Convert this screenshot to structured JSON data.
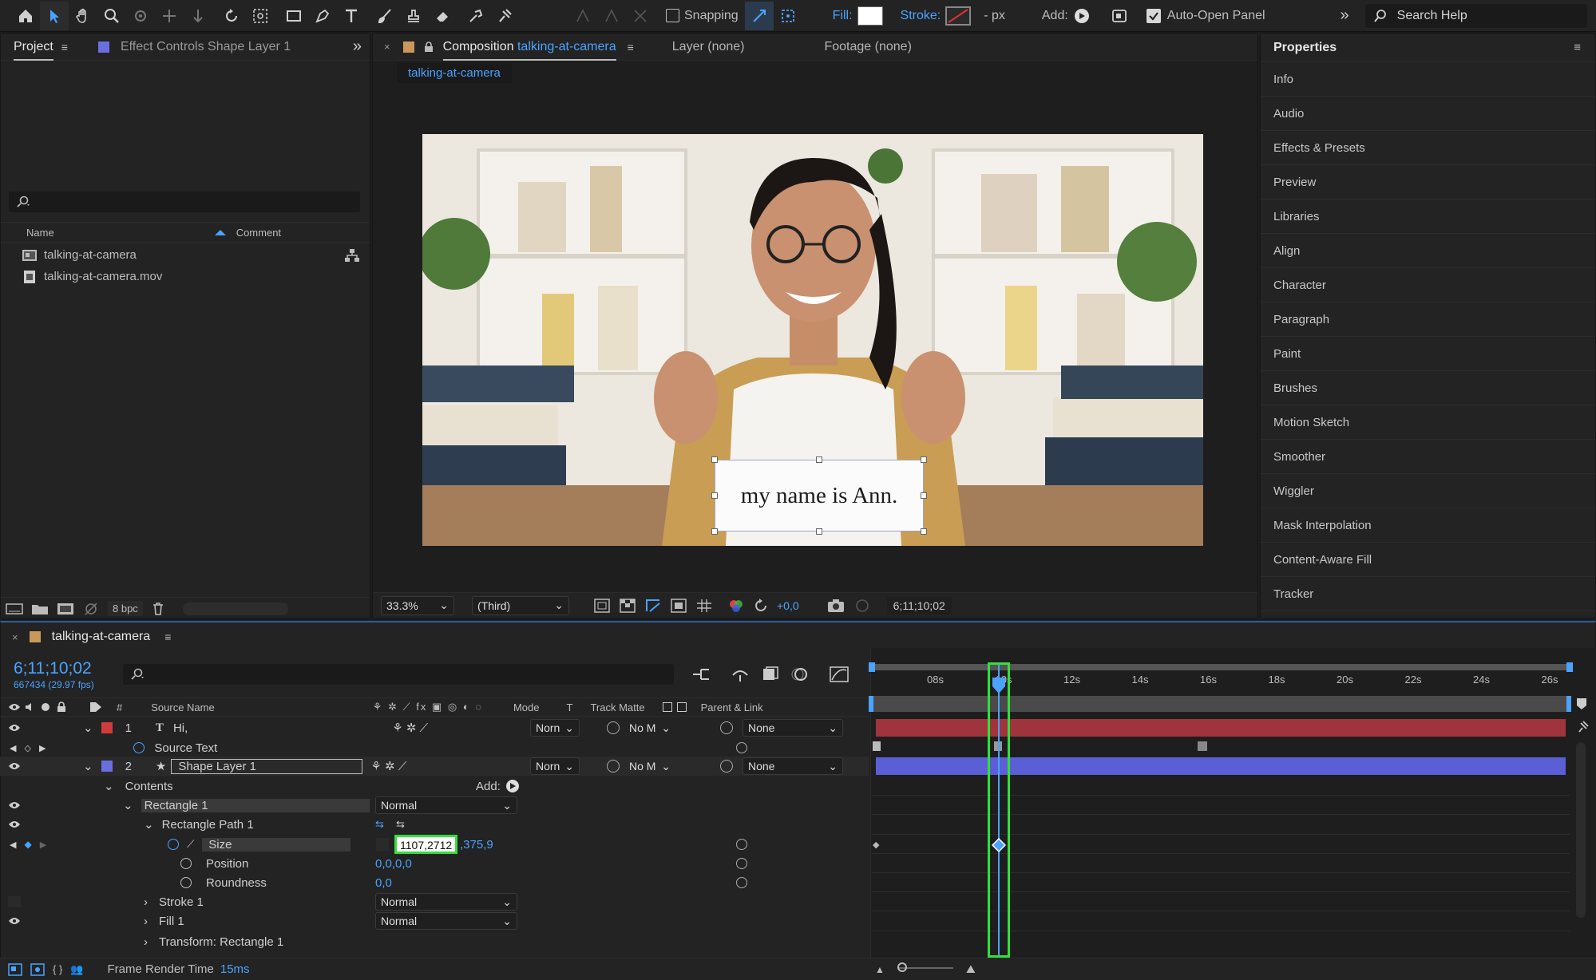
{
  "toolbar": {
    "snapping_label": "Snapping",
    "fill_label": "Fill:",
    "stroke_label": "Stroke:",
    "px_label": "- px",
    "add_label": "Add:",
    "auto_open_label": "Auto-Open Panel",
    "search_placeholder": "Search Help"
  },
  "project_panel": {
    "tab_project": "Project",
    "tab_effect_controls": "Effect Controls Shape Layer 1",
    "col_name": "Name",
    "col_comment": "Comment",
    "items": [
      {
        "name": "talking-at-camera",
        "icon": "composition-icon"
      },
      {
        "name": "talking-at-camera.mov",
        "icon": "footage-icon"
      }
    ],
    "bpc_label": "8 bpc"
  },
  "comp_panel": {
    "tab_prefix": "Composition",
    "tab_comp_name": "talking-at-camera",
    "tab_layer": "Layer (none)",
    "tab_footage": "Footage (none)",
    "subtab": "talking-at-camera",
    "caption_text": "my name is Ann.",
    "zoom_value": "33.3%",
    "resolution_value": "(Third)",
    "exposure_value": "+0,0",
    "timecode": "6;11;10;02"
  },
  "properties_panel": {
    "title": "Properties",
    "items": [
      "Info",
      "Audio",
      "Effects & Presets",
      "Preview",
      "Libraries",
      "Align",
      "Character",
      "Paragraph",
      "Paint",
      "Brushes",
      "Motion Sketch",
      "Smoother",
      "Wiggler",
      "Mask Interpolation",
      "Content-Aware Fill",
      "Tracker"
    ]
  },
  "timeline": {
    "tab_name": "talking-at-camera",
    "timecode": "6;11;10;02",
    "frames_info": "667434 (29.97 fps)",
    "col_source_name": "Source Name",
    "col_hash": "#",
    "col_mode": "Mode",
    "col_t": "T",
    "col_track_matte": "Track Matte",
    "col_parent": "Parent & Link",
    "layers": [
      {
        "num": "1",
        "name": "Hi,",
        "mode": "Norn",
        "matte": "No M",
        "parent": "None"
      },
      {
        "num": "2",
        "name": "Shape Layer 1",
        "mode": "Norn",
        "matte": "No M",
        "parent": "None"
      }
    ],
    "source_text_label": "Source Text",
    "contents_label": "Contents",
    "add_label": "Add:",
    "rectangle_label": "Rectangle 1",
    "rectangle_mode": "Normal",
    "rect_path_label": "Rectangle Path 1",
    "size_label": "Size",
    "size_value_editing": "1107,2712",
    "size_value_rest": ",375,9",
    "position_label": "Position",
    "position_value": "0,0,0,0",
    "roundness_label": "Roundness",
    "roundness_value": "0,0",
    "stroke_label": "Stroke 1",
    "stroke_mode": "Normal",
    "fill_label": "Fill 1",
    "fill_mode": "Normal",
    "transform_label": "Transform: Rectangle 1",
    "ruler_ticks": [
      "08s",
      "10s",
      "12s",
      "14s",
      "16s",
      "18s",
      "20s",
      "22s",
      "24s",
      "26s"
    ],
    "frame_render_label": "Frame Render Time",
    "frame_render_value": "15ms"
  },
  "colors": {
    "accent": "#4aa3ff",
    "highlight": "#33e03a",
    "layer1_bar": "#a0343c",
    "layer2_bar": "#5a5fd6"
  }
}
